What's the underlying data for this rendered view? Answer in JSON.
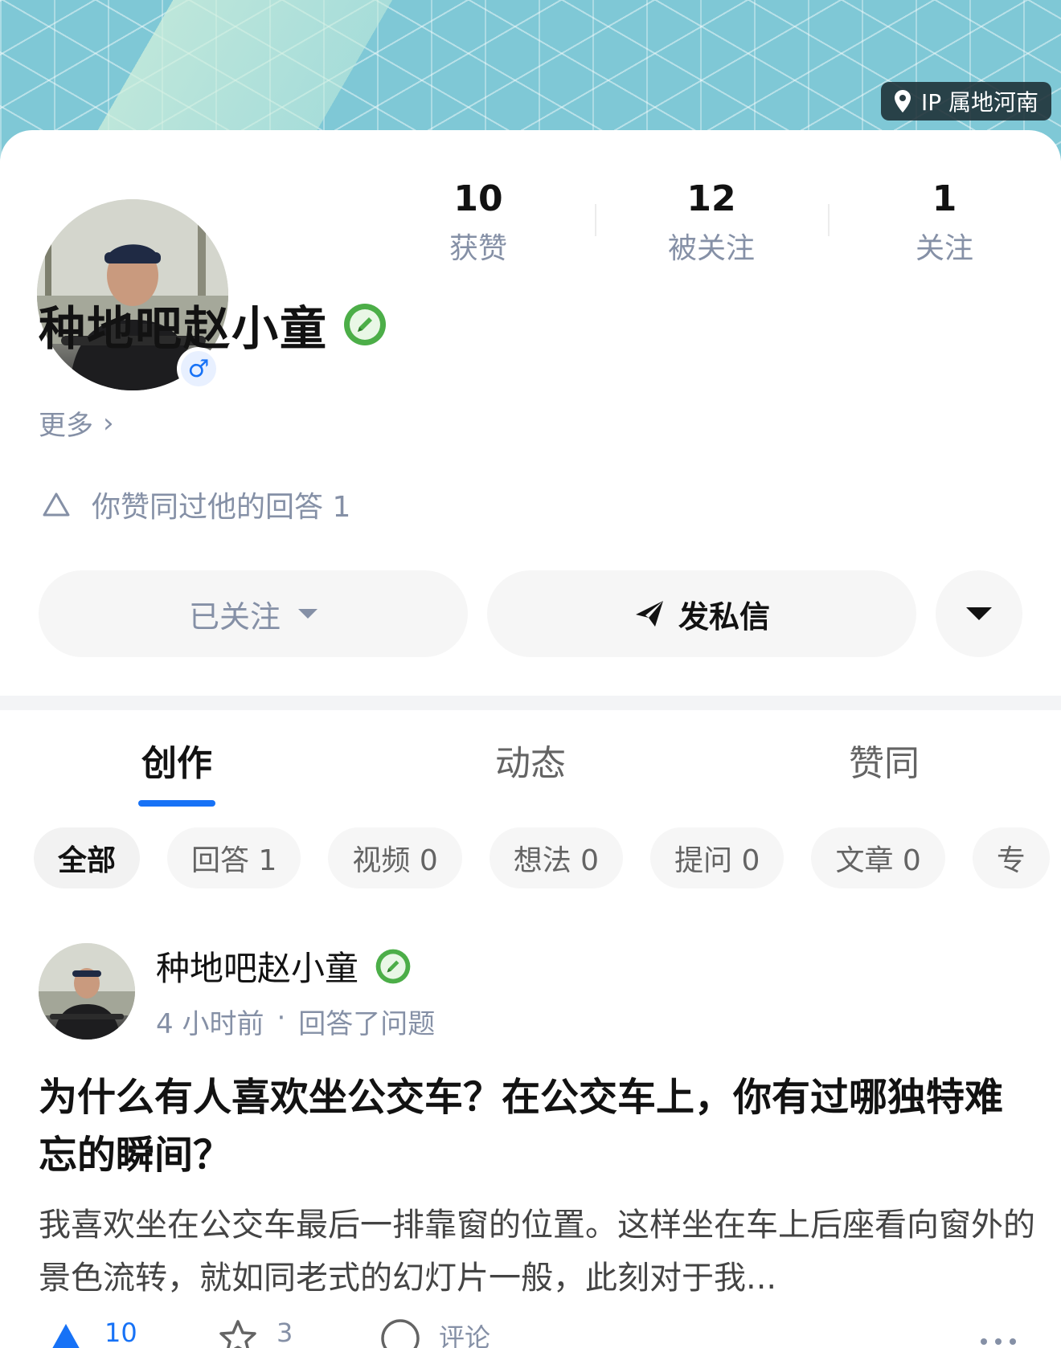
{
  "colors": {
    "brand_blue": "#1772f6",
    "text_primary": "#121212",
    "text_secondary": "#8590a6",
    "badge_green": "#4cae48"
  },
  "header": {
    "ip_location": "IP 属地河南"
  },
  "stats": [
    {
      "value": "10",
      "label": "获赞"
    },
    {
      "value": "12",
      "label": "被关注"
    },
    {
      "value": "1",
      "label": "关注"
    }
  ],
  "profile": {
    "name": "种地吧赵小童",
    "gender_icon": "♂",
    "more_label": "更多",
    "more_chevron": "›",
    "agreed_text": "你赞同过他的回答 1"
  },
  "buttons": {
    "follow": "已关注",
    "message": "发私信"
  },
  "tabs": [
    "创作",
    "动态",
    "赞同"
  ],
  "chips": [
    "全部",
    "回答 1",
    "视频 0",
    "想法 0",
    "提问 0",
    "文章 0",
    "专"
  ],
  "feed": {
    "author": "种地吧赵小童",
    "time": "4 小时前",
    "separator": "·",
    "action": "回答了问题",
    "question": "为什么有人喜欢坐公交车？在公交车上，你有过哪独特难忘的瞬间？",
    "excerpt": "我喜欢坐在公交车最后一排靠窗的位置。这样坐在车上后座看向窗外的景色流转，就如同老式的幻灯片一般，此刻对于我...",
    "upvotes": "10",
    "favorites": "3",
    "comment_label": "评论"
  },
  "icons": [
    "location-pin-icon",
    "male-icon",
    "pen-badge-icon",
    "chevron-right-icon",
    "upvote-outline-icon",
    "paper-plane-icon",
    "caret-down-icon",
    "upvote-icon",
    "star-icon",
    "comment-icon",
    "more-icon"
  ]
}
